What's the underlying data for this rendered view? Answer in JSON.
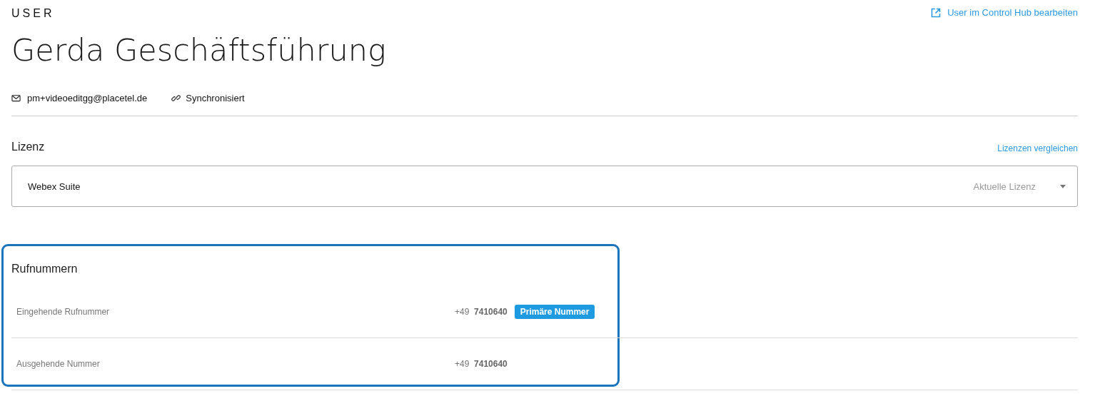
{
  "header": {
    "eyebrow": "USER",
    "title": "Gerda Geschäftsführung",
    "edit_link": "User im Control Hub bearbeiten"
  },
  "meta": {
    "email": "pm+videoeditgg@placetel.de",
    "sync_status": "Synchronisiert"
  },
  "license": {
    "heading": "Lizenz",
    "compare_link": "Lizenzen vergleichen",
    "value": "Webex Suite",
    "hint": "Aktuelle Lizenz"
  },
  "numbers": {
    "heading": "Rufnummern",
    "highlighted": true,
    "rows": [
      {
        "label": "Eingehende Rufnummer",
        "number": "+49  **7410640**",
        "badge": "Primäre Nummer"
      },
      {
        "label": "Ausgehende Nummer",
        "number": "+49  **7410640**"
      }
    ]
  }
}
